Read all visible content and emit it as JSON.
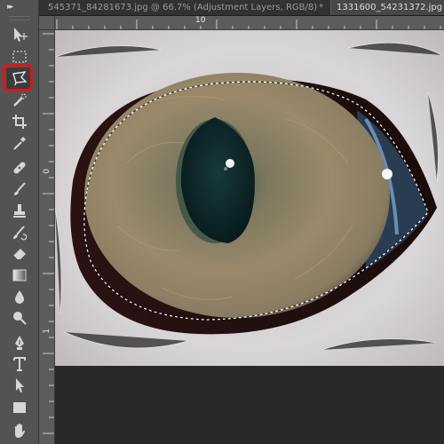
{
  "toolbar": {
    "collapse_glyph": "▸▸",
    "tools": [
      {
        "name": "move-tool",
        "icon": "move-icon"
      },
      {
        "name": "rectangular-marquee-tool",
        "icon": "marquee-icon"
      },
      {
        "name": "polygonal-lasso-tool",
        "icon": "polygonal-lasso-icon",
        "selected": true
      },
      {
        "name": "quick-selection-tool",
        "icon": "quick-selection-icon"
      },
      {
        "name": "crop-tool",
        "icon": "crop-icon"
      },
      {
        "name": "eyedropper-tool",
        "icon": "eyedropper-icon"
      },
      {
        "name": "spot-healing-brush-tool",
        "icon": "bandage-icon"
      },
      {
        "name": "brush-tool",
        "icon": "brush-icon"
      },
      {
        "name": "clone-stamp-tool",
        "icon": "stamp-icon"
      },
      {
        "name": "history-brush-tool",
        "icon": "history-brush-icon"
      },
      {
        "name": "eraser-tool",
        "icon": "eraser-icon"
      },
      {
        "name": "gradient-tool",
        "icon": "gradient-icon"
      },
      {
        "name": "blur-tool",
        "icon": "blur-drop-icon"
      },
      {
        "name": "dodge-tool",
        "icon": "dodge-icon"
      },
      {
        "name": "pen-tool",
        "icon": "pen-icon"
      },
      {
        "name": "type-tool",
        "icon": "type-icon"
      },
      {
        "name": "path-selection-tool",
        "icon": "path-selection-icon"
      },
      {
        "name": "rectangle-tool",
        "icon": "rectangle-icon"
      },
      {
        "name": "hand-tool",
        "icon": "hand-icon"
      }
    ],
    "highlight_color": "#e0141b"
  },
  "tabs": [
    {
      "title": "545371_84281673.jpg @ 66.7% (Adjustment Layers, RGB/8)",
      "close": "*",
      "active": false
    },
    {
      "title": "1331600_54231372.jpg",
      "active": true
    }
  ],
  "rulers": {
    "top_label": "10",
    "left_labels": [
      "0",
      "1"
    ]
  },
  "colors": {
    "ui_dark": "#282828",
    "panel": "#535353",
    "ruler": "#5c5c5c",
    "iris": "#8c7d5e",
    "pupil": "#0f2a2c",
    "fur": "#d8d4d6"
  },
  "image": {
    "description_hidden": true,
    "selection": "polygonal-lasso-marching-ants"
  }
}
